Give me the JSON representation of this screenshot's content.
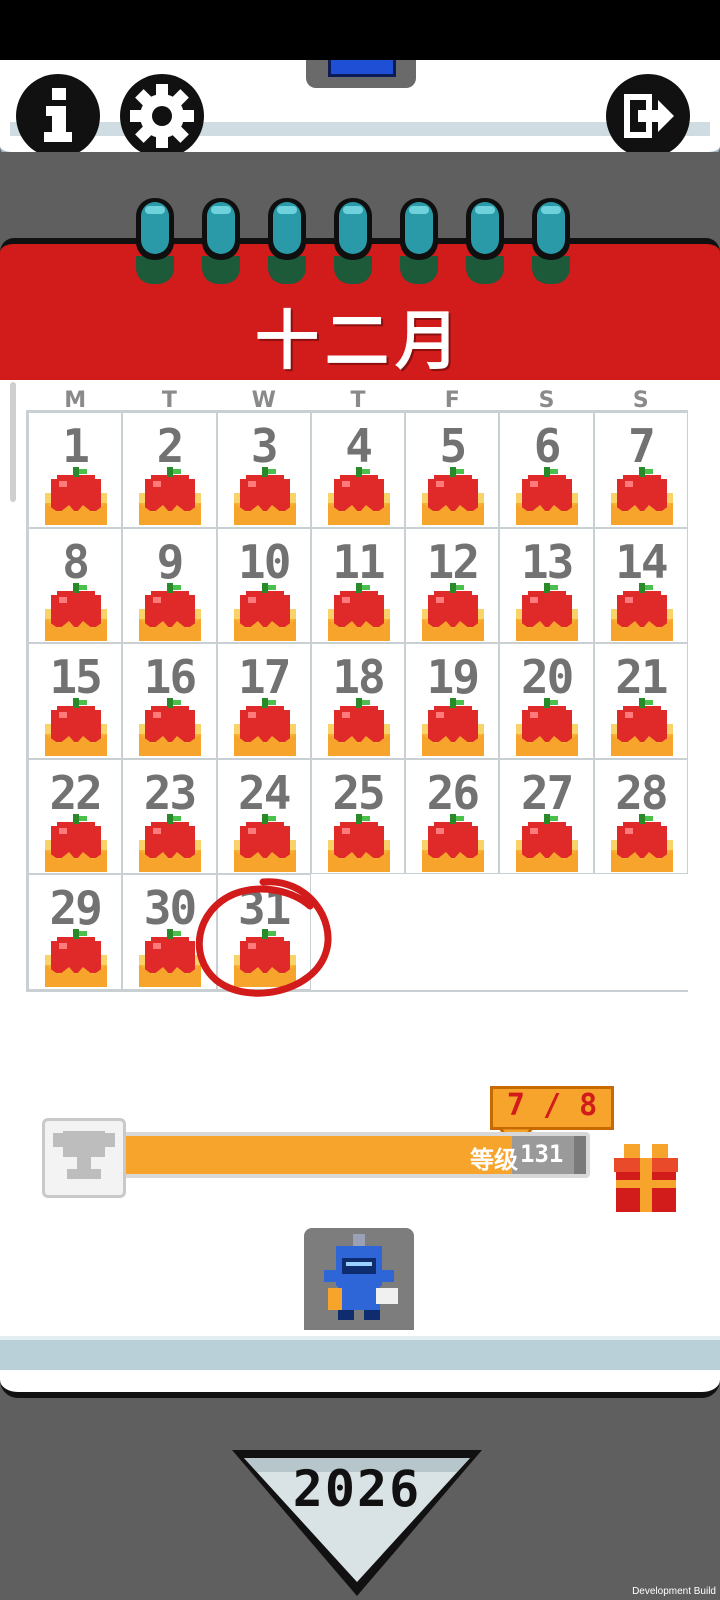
{
  "calendar": {
    "month": "十二月",
    "weekdays": [
      "M",
      "T",
      "W",
      "T",
      "F",
      "S",
      "S"
    ],
    "days": [
      "1",
      "2",
      "3",
      "4",
      "5",
      "6",
      "7",
      "8",
      "9",
      "10",
      "11",
      "12",
      "13",
      "14",
      "15",
      "16",
      "17",
      "18",
      "19",
      "20",
      "21",
      "22",
      "23",
      "24",
      "25",
      "26",
      "27",
      "28",
      "29",
      "30",
      "31"
    ],
    "today": "31"
  },
  "progress": {
    "label": "等级",
    "level": "131",
    "fill": 0.82,
    "bubble": "7 / 8"
  },
  "year": "2026",
  "footer": {
    "build": "Development Build"
  },
  "icons": {
    "info": "info-icon",
    "settings": "gear-icon",
    "exit": "exit-icon",
    "trophy": "trophy-icon",
    "gift": "gift-icon",
    "avatar": "knight-avatar-icon"
  },
  "colors": {
    "header": "#d21b1b",
    "background": "#5f5f5f",
    "progress": "#f7a42d"
  }
}
